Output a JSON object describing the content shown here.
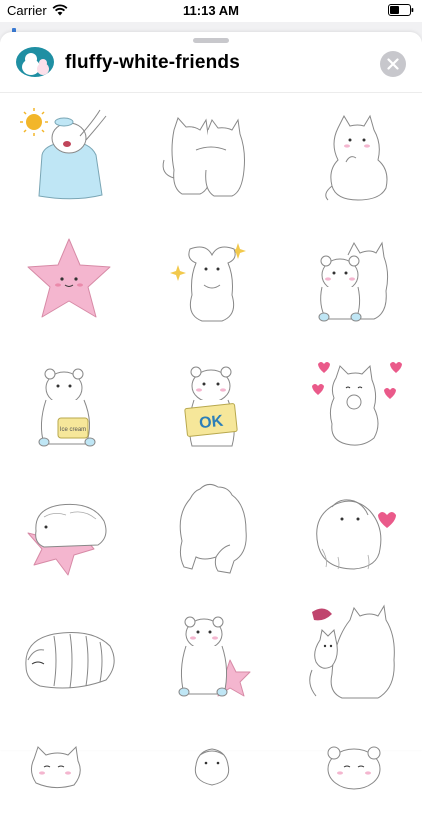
{
  "status_bar": {
    "carrier": "Carrier",
    "time": "11:13 AM",
    "wifi_icon": "wifi-icon",
    "battery_icon": "battery-icon"
  },
  "header": {
    "app_name": "fluffy-white-friends",
    "close_icon": "close-icon"
  },
  "colors": {
    "sheet_background": "#ffffff",
    "app_icon_background": "#1f8fa3",
    "close_button": "#c7c7cc",
    "sticker_blue": "#bfe6f5",
    "sticker_pink": "#f4b6cf",
    "sticker_yellow": "#f6e79a",
    "sun": "#f2b62a"
  },
  "stickers": [
    {
      "name": "sticker-bear-waking-in-blanket"
    },
    {
      "name": "sticker-two-cats-hugging-back"
    },
    {
      "name": "sticker-cat-thinking"
    },
    {
      "name": "sticker-pink-star"
    },
    {
      "name": "sticker-sparkling-bunny"
    },
    {
      "name": "sticker-bear-and-cat-together"
    },
    {
      "name": "sticker-bear-eating-ice-cream",
      "text": "Ice cream"
    },
    {
      "name": "sticker-bear-holding-ok-sign",
      "text": "OK"
    },
    {
      "name": "sticker-cat-with-hearts"
    },
    {
      "name": "sticker-guinea-pig-on-pink-star"
    },
    {
      "name": "sticker-bear-from-behind"
    },
    {
      "name": "sticker-guinea-pig-with-heart"
    },
    {
      "name": "sticker-guinea-pig-sleeping"
    },
    {
      "name": "sticker-bear-with-pink-star"
    },
    {
      "name": "sticker-cat-hugging-small-cat"
    },
    {
      "name": "sticker-cat-partial"
    },
    {
      "name": "sticker-guinea-pig-partial"
    },
    {
      "name": "sticker-bear-partial"
    }
  ]
}
